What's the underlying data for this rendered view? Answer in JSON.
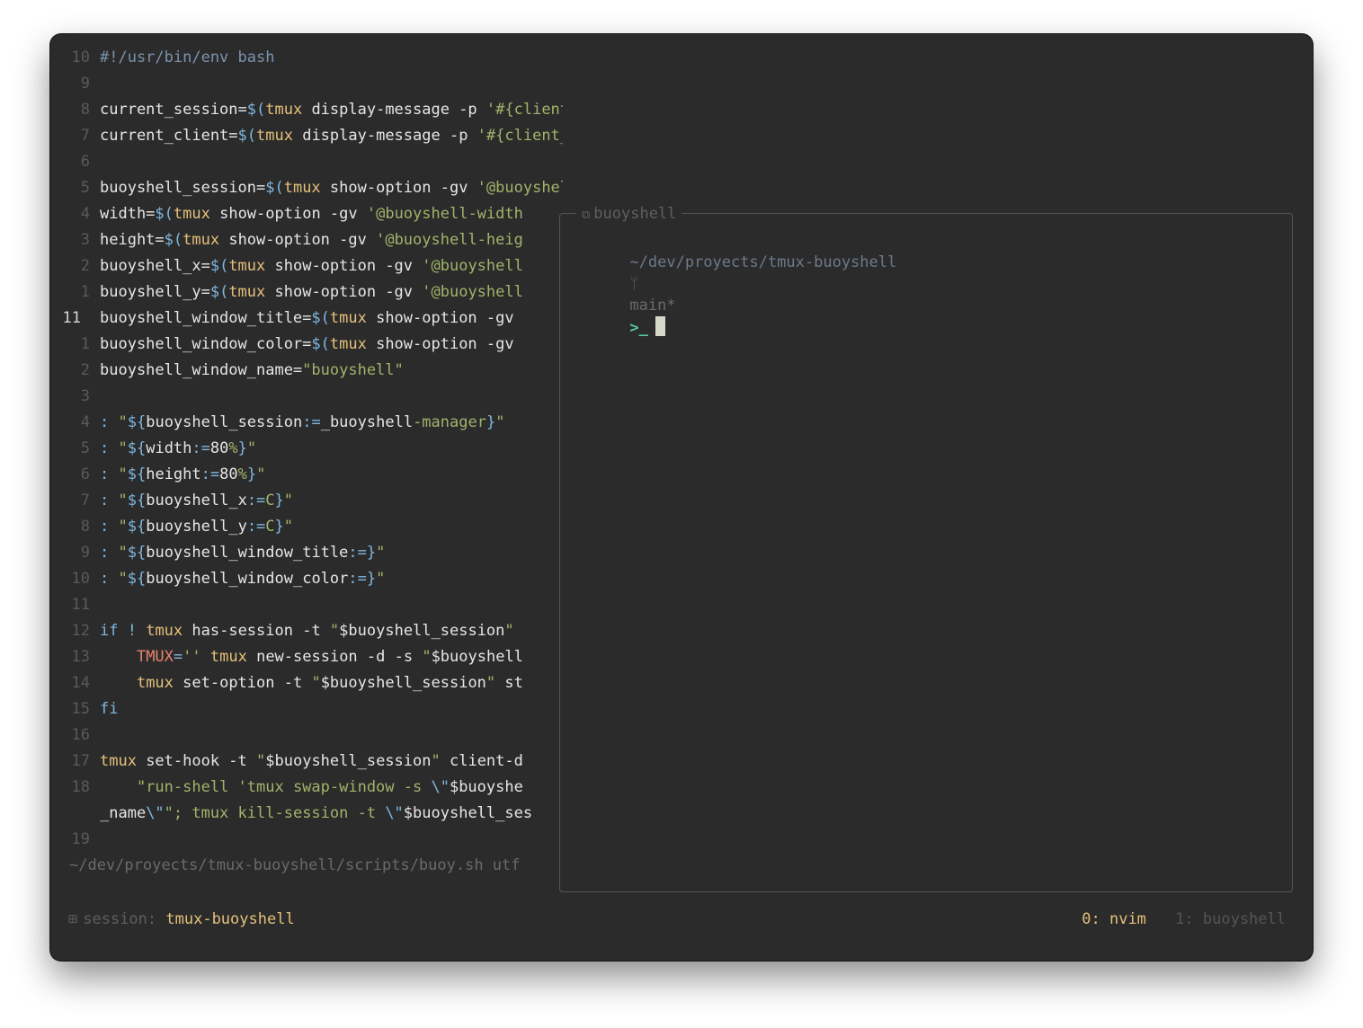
{
  "editor": {
    "lines": [
      {
        "n": "10",
        "tokens": [
          [
            "cm",
            "#!/usr/bin/env bash"
          ]
        ]
      },
      {
        "n": "9",
        "tokens": []
      },
      {
        "n": "8",
        "tokens": [
          [
            "pl",
            "current_session="
          ],
          [
            "op",
            "$("
          ],
          [
            "kw",
            "tmux"
          ],
          [
            "pl",
            " display-message -p "
          ],
          [
            "st",
            "'#{client_session}'"
          ],
          [
            "op",
            ")"
          ]
        ]
      },
      {
        "n": "7",
        "tokens": [
          [
            "pl",
            "current_client="
          ],
          [
            "op",
            "$("
          ],
          [
            "kw",
            "tmux"
          ],
          [
            "pl",
            " display-message -p "
          ],
          [
            "st",
            "'#{client_name}'"
          ],
          [
            "op",
            ")"
          ]
        ]
      },
      {
        "n": "6",
        "tokens": []
      },
      {
        "n": "5",
        "tokens": [
          [
            "pl",
            "buoyshell_session="
          ],
          [
            "op",
            "$("
          ],
          [
            "kw",
            "tmux"
          ],
          [
            "pl",
            " show-option -gv "
          ],
          [
            "st",
            "'@buoyshell-session'"
          ],
          [
            "op",
            ")"
          ]
        ]
      },
      {
        "n": "4",
        "tokens": [
          [
            "pl",
            "width="
          ],
          [
            "op",
            "$("
          ],
          [
            "kw",
            "tmux"
          ],
          [
            "pl",
            " show-option -gv "
          ],
          [
            "st",
            "'@buoyshell-width"
          ]
        ]
      },
      {
        "n": "3",
        "tokens": [
          [
            "pl",
            "height="
          ],
          [
            "op",
            "$("
          ],
          [
            "kw",
            "tmux"
          ],
          [
            "pl",
            " show-option -gv "
          ],
          [
            "st",
            "'@buoyshell-heig"
          ]
        ]
      },
      {
        "n": "2",
        "tokens": [
          [
            "pl",
            "buoyshell_x="
          ],
          [
            "op",
            "$("
          ],
          [
            "kw",
            "tmux"
          ],
          [
            "pl",
            " show-option -gv "
          ],
          [
            "st",
            "'@buoyshell"
          ]
        ]
      },
      {
        "n": "1",
        "tokens": [
          [
            "pl",
            "buoyshell_y="
          ],
          [
            "op",
            "$("
          ],
          [
            "kw",
            "tmux"
          ],
          [
            "pl",
            " show-option -gv "
          ],
          [
            "st",
            "'@buoyshell"
          ]
        ]
      },
      {
        "n": "11",
        "cur": true,
        "tokens": [
          [
            "pl",
            "buoyshell_window_title="
          ],
          [
            "op",
            "$("
          ],
          [
            "kw",
            "tmux"
          ],
          [
            "pl",
            " show-option -gv"
          ]
        ]
      },
      {
        "n": "1",
        "tokens": [
          [
            "pl",
            "buoyshell_window_color="
          ],
          [
            "op",
            "$("
          ],
          [
            "kw",
            "tmux"
          ],
          [
            "pl",
            " show-option -gv"
          ]
        ]
      },
      {
        "n": "2",
        "tokens": [
          [
            "pl",
            "buoyshell_window_name="
          ],
          [
            "st",
            "\"buoyshell\""
          ]
        ]
      },
      {
        "n": "3",
        "tokens": []
      },
      {
        "n": "4",
        "tokens": [
          [
            "op",
            ": "
          ],
          [
            "st",
            "\""
          ],
          [
            "pu",
            "${"
          ],
          [
            "va",
            "buoyshell_session"
          ],
          [
            "pu",
            ":="
          ],
          [
            "pl",
            "_buoyshell"
          ],
          [
            "st",
            "-manager"
          ],
          [
            "pu",
            "}"
          ],
          [
            "st",
            "\""
          ]
        ]
      },
      {
        "n": "5",
        "tokens": [
          [
            "op",
            ": "
          ],
          [
            "st",
            "\""
          ],
          [
            "pu",
            "${"
          ],
          [
            "va",
            "width"
          ],
          [
            "pu",
            ":="
          ],
          [
            "nu",
            "80"
          ],
          [
            "st",
            "%"
          ],
          [
            "pu",
            "}"
          ],
          [
            "st",
            "\""
          ]
        ]
      },
      {
        "n": "6",
        "tokens": [
          [
            "op",
            ": "
          ],
          [
            "st",
            "\""
          ],
          [
            "pu",
            "${"
          ],
          [
            "va",
            "height"
          ],
          [
            "pu",
            ":="
          ],
          [
            "nu",
            "80"
          ],
          [
            "st",
            "%"
          ],
          [
            "pu",
            "}"
          ],
          [
            "st",
            "\""
          ]
        ]
      },
      {
        "n": "7",
        "tokens": [
          [
            "op",
            ": "
          ],
          [
            "st",
            "\""
          ],
          [
            "pu",
            "${"
          ],
          [
            "va",
            "buoyshell_x"
          ],
          [
            "pu",
            ":="
          ],
          [
            "st",
            "C"
          ],
          [
            "pu",
            "}"
          ],
          [
            "st",
            "\""
          ]
        ]
      },
      {
        "n": "8",
        "tokens": [
          [
            "op",
            ": "
          ],
          [
            "st",
            "\""
          ],
          [
            "pu",
            "${"
          ],
          [
            "va",
            "buoyshell_y"
          ],
          [
            "pu",
            ":="
          ],
          [
            "st",
            "C"
          ],
          [
            "pu",
            "}"
          ],
          [
            "st",
            "\""
          ]
        ]
      },
      {
        "n": "9",
        "tokens": [
          [
            "op",
            ": "
          ],
          [
            "st",
            "\""
          ],
          [
            "pu",
            "${"
          ],
          [
            "va",
            "buoyshell_window_title"
          ],
          [
            "pu",
            ":="
          ],
          [
            "pu",
            "}"
          ],
          [
            "st",
            "\""
          ]
        ]
      },
      {
        "n": "10",
        "tokens": [
          [
            "op",
            ": "
          ],
          [
            "st",
            "\""
          ],
          [
            "pu",
            "${"
          ],
          [
            "va",
            "buoyshell_window_color"
          ],
          [
            "pu",
            ":="
          ],
          [
            "pu",
            "}"
          ],
          [
            "st",
            "\""
          ]
        ]
      },
      {
        "n": "11",
        "tokens": []
      },
      {
        "n": "12",
        "tokens": [
          [
            "if",
            "if"
          ],
          [
            "op",
            " ! "
          ],
          [
            "kw",
            "tmux"
          ],
          [
            "pl",
            " has-session -t "
          ],
          [
            "st",
            "\""
          ],
          [
            "va",
            "$buoyshell_session"
          ],
          [
            "st",
            "\""
          ]
        ]
      },
      {
        "n": "13",
        "tokens": [
          [
            "pl",
            "    "
          ],
          [
            "en",
            "TMUX"
          ],
          [
            "op",
            "="
          ],
          [
            "st",
            "''"
          ],
          [
            "pl",
            " "
          ],
          [
            "kw",
            "tmux"
          ],
          [
            "pl",
            " new-session -d -s "
          ],
          [
            "st",
            "\""
          ],
          [
            "va",
            "$buoyshell"
          ]
        ]
      },
      {
        "n": "14",
        "tokens": [
          [
            "pl",
            "    "
          ],
          [
            "kw",
            "tmux"
          ],
          [
            "pl",
            " set-option -t "
          ],
          [
            "st",
            "\""
          ],
          [
            "va",
            "$buoyshell_session"
          ],
          [
            "st",
            "\""
          ],
          [
            "pl",
            " st"
          ]
        ]
      },
      {
        "n": "15",
        "tokens": [
          [
            "if",
            "fi"
          ]
        ]
      },
      {
        "n": "16",
        "tokens": []
      },
      {
        "n": "17",
        "tokens": [
          [
            "kw",
            "tmux"
          ],
          [
            "pl",
            " set-hook -t "
          ],
          [
            "st",
            "\""
          ],
          [
            "va",
            "$buoyshell_session"
          ],
          [
            "st",
            "\""
          ],
          [
            "pl",
            " client-d"
          ]
        ]
      },
      {
        "n": "18",
        "tokens": [
          [
            "pl",
            "    "
          ],
          [
            "st",
            "\"run-shell 'tmux swap-window -s "
          ],
          [
            "op",
            "\\\""
          ],
          [
            "va",
            "$buoyshe"
          ]
        ]
      },
      {
        "n": "",
        "tokens": [
          [
            "pl",
            "_name"
          ],
          [
            "op",
            "\\\""
          ],
          [
            "st",
            "\"; tmux kill-session -t "
          ],
          [
            "op",
            "\\\""
          ],
          [
            "va",
            "$buoyshell_ses"
          ]
        ]
      },
      {
        "n": "19",
        "tokens": []
      }
    ],
    "statusline": "~/dev/proyects/tmux-buoyshell/scripts/buoy.sh utf"
  },
  "popup": {
    "title": "buoyshell",
    "title_icon": "window-icon",
    "prompt_path": "~/dev/proyects/tmux-buoyshell",
    "branch_icon": "git-branch-icon",
    "branch": "main*",
    "prompt_symbol": ">_"
  },
  "tmux_status": {
    "session_icon": "session-grid-icon",
    "session_label": "session:",
    "session_name": "tmux-buoyshell",
    "windows": [
      {
        "label": "0: nvim",
        "active": true
      },
      {
        "label": "1: buoyshell",
        "active": false
      }
    ]
  }
}
